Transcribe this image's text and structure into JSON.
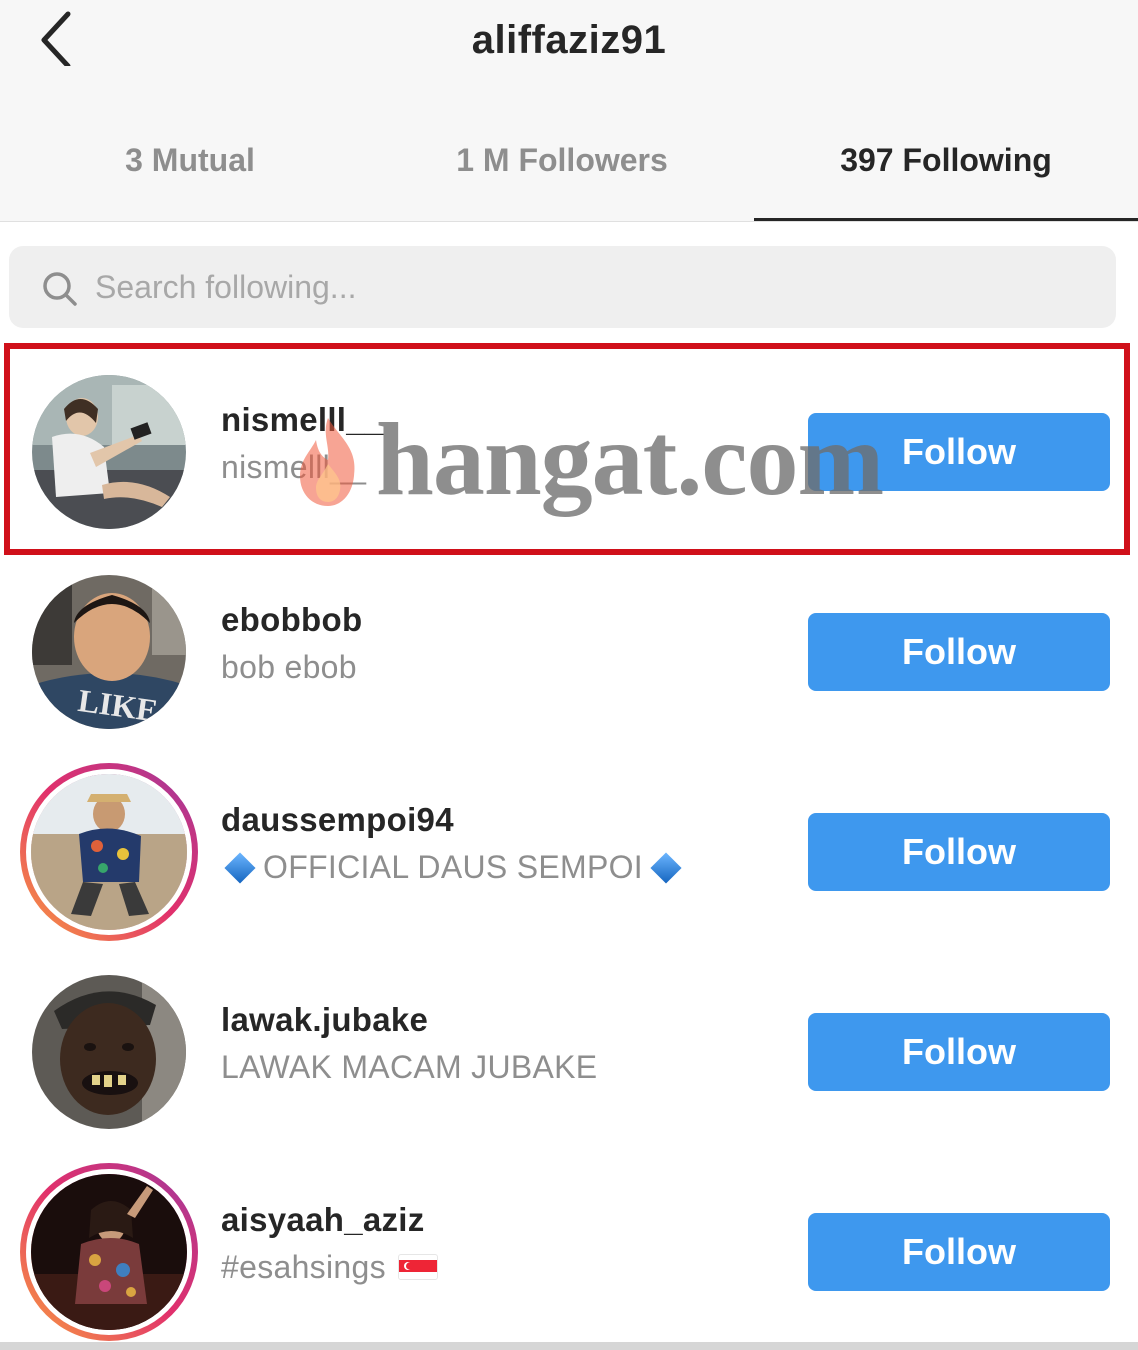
{
  "header": {
    "title": "aliffaziz91",
    "back_icon": "chevron-left-icon"
  },
  "tabs": [
    {
      "label": "3 Mutual",
      "active": false
    },
    {
      "label": "1 M Followers",
      "active": false
    },
    {
      "label": "397 Following",
      "active": true
    }
  ],
  "search": {
    "placeholder": "Search following...",
    "value": "",
    "icon": "search-icon"
  },
  "accounts": [
    {
      "username": "nismelll__",
      "fullname": "nismelll__",
      "button": "Follow",
      "story_ring": false,
      "highlighted": true
    },
    {
      "username": "ebobbob",
      "fullname": "bob ebob",
      "button": "Follow",
      "story_ring": false
    },
    {
      "username": "daussempoi94",
      "fullname": "OFFICIAL DAUS SEMPOI",
      "button": "Follow",
      "story_ring": true,
      "emoji": "blue-diamond-icon"
    },
    {
      "username": "lawak.jubake",
      "fullname": "LAWAK MACAM JUBAKE",
      "button": "Follow",
      "story_ring": false
    },
    {
      "username": "aisyaah_aziz",
      "fullname": "#esahsings",
      "button": "Follow",
      "story_ring": true,
      "emoji": "singapore-flag-icon"
    }
  ],
  "watermark": {
    "text": "hangat.com"
  },
  "colors": {
    "follow_button": "#3e98ee",
    "highlight_border": "#d0101a",
    "secondary_text": "#8e8e8e"
  }
}
